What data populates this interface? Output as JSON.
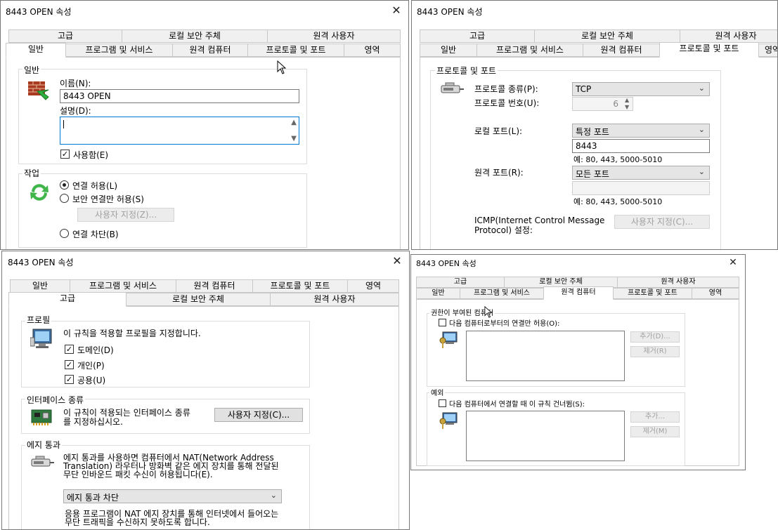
{
  "dialog_title": "8443 OPEN 속성",
  "close_glyph": "✕",
  "tabs": {
    "advanced": "고급",
    "local_principals": "로컬 보안 주체",
    "remote_users": "원격 사용자",
    "general": "일반",
    "programs_services": "프로그램 및 서비스",
    "remote_computers": "원격 컴퓨터",
    "protocols_ports": "프로토콜 및 포트",
    "scope": "영역"
  },
  "general": {
    "group_label": "일반",
    "name_label": "이름(N):",
    "name_value": "8443 OPEN",
    "description_label": "설명(D):",
    "enabled_label": "사용함(E)",
    "action_group": "작업",
    "allow": "연결 허용(L)",
    "allow_secure": "보안 연결만 허용(S)",
    "customize": "사용자 지정(Z)...",
    "block": "연결 차단(B)"
  },
  "protocols": {
    "group_label": "프로토콜 및 포트",
    "protocol_type_label": "프로토콜 종류(P):",
    "protocol_type_value": "TCP",
    "protocol_number_label": "프로토콜 번호(U):",
    "protocol_number_value": "6",
    "local_port_label": "로컬 포트(L):",
    "local_port_value": "특정 포트",
    "local_port_input": "8443",
    "example": "예: 80, 443, 5000-5010",
    "remote_port_label": "원격 포트(R):",
    "remote_port_value": "모든 포트",
    "icmp_line1": "ICMP(Internet Control Message",
    "icmp_line2": "Protocol) 설정:",
    "customize": "사용자 지정(C)..."
  },
  "advanced": {
    "profiles_group": "프로필",
    "profiles_desc": "이 규칙을 적용할 프로필을 지정합니다.",
    "domain": "도메인(D)",
    "private": "개인(P)",
    "public": "공용(U)",
    "interface_group": "인터페이스 종류",
    "interface_line1": "이 규칙이 적용되는 인터페이스 종류",
    "interface_line2": "를 지정하십시오.",
    "interface_button": "사용자 지정(C)...",
    "edge_group": "에지 통과",
    "edge_line1": "에지 통과를 사용하면 컴퓨터에서 NAT(Network Address",
    "edge_line2": "Translation) 라우터나 방화벽 같은 에지 장치를 통해 전달된",
    "edge_line3": "무단 인바운드 패킷 수신이 허용됩니다(E).",
    "edge_select": "에지 통과 차단",
    "edge_note1": "응용 프로그램이 NAT 에지 장치를 통해 인터넷에서 들어오는",
    "edge_note2": "무단 트래픽을 수신하지 못하도록 합니다."
  },
  "remote": {
    "authorized_group": "권한이 부여된 컴퓨터",
    "authorized_check": "다음 컴퓨터로부터의 연결만 허용(O):",
    "add1": "추가(D)...",
    "remove1": "제거(R)",
    "exceptions_group": "예외",
    "exceptions_check": "다음 컴퓨터에서 연결할 때 이 규칙 건너뜀(S):",
    "add2": "추가...",
    "remove2": "제거(M)"
  },
  "check_glyph": "✓",
  "spin_up": "▲",
  "spin_down": "▼",
  "chevron": "⌄"
}
